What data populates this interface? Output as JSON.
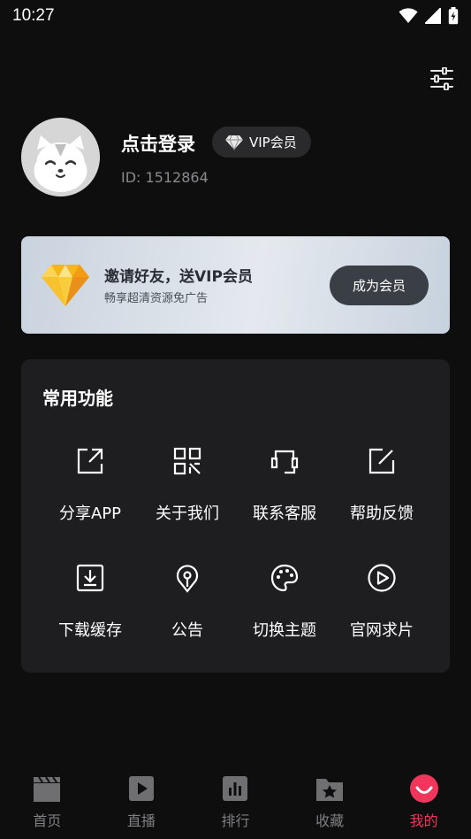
{
  "status_bar": {
    "time": "10:27",
    "icons": [
      "wifi-icon",
      "signal-icon",
      "battery-charging-icon"
    ]
  },
  "header": {
    "settings_icon": "sliders-icon"
  },
  "profile": {
    "login_text": "点击登录",
    "vip_badge": "VIP会员",
    "user_id": "ID: 1512864",
    "avatar_icon": "cartoon-cat-avatar"
  },
  "vip_banner": {
    "title": "邀请好友，送VIP会员",
    "subtitle": "畅享超清资源免广告",
    "button": "成为会员",
    "icon": "diamond-icon"
  },
  "features": {
    "title": "常用功能",
    "items": [
      {
        "label": "分享APP",
        "icon": "share-icon"
      },
      {
        "label": "关于我们",
        "icon": "qr-code-icon"
      },
      {
        "label": "联系客服",
        "icon": "headset-icon"
      },
      {
        "label": "帮助反馈",
        "icon": "edit-feedback-icon"
      },
      {
        "label": "下载缓存",
        "icon": "download-icon"
      },
      {
        "label": "公告",
        "icon": "announcement-icon"
      },
      {
        "label": "切换主题",
        "icon": "palette-icon"
      },
      {
        "label": "官网求片",
        "icon": "play-circle-icon"
      }
    ]
  },
  "bottom_nav": {
    "items": [
      {
        "label": "首页",
        "icon": "clapperboard-icon",
        "active": false
      },
      {
        "label": "直播",
        "icon": "live-play-icon",
        "active": false
      },
      {
        "label": "排行",
        "icon": "ranking-icon",
        "active": false
      },
      {
        "label": "收藏",
        "icon": "favorites-folder-icon",
        "active": false
      },
      {
        "label": "我的",
        "icon": "smile-face-icon",
        "active": true
      }
    ]
  },
  "colors": {
    "background": "#0e0e0f",
    "card": "#1e1e20",
    "accent": "#f2365b",
    "nav_inactive": "#7f7f82"
  }
}
